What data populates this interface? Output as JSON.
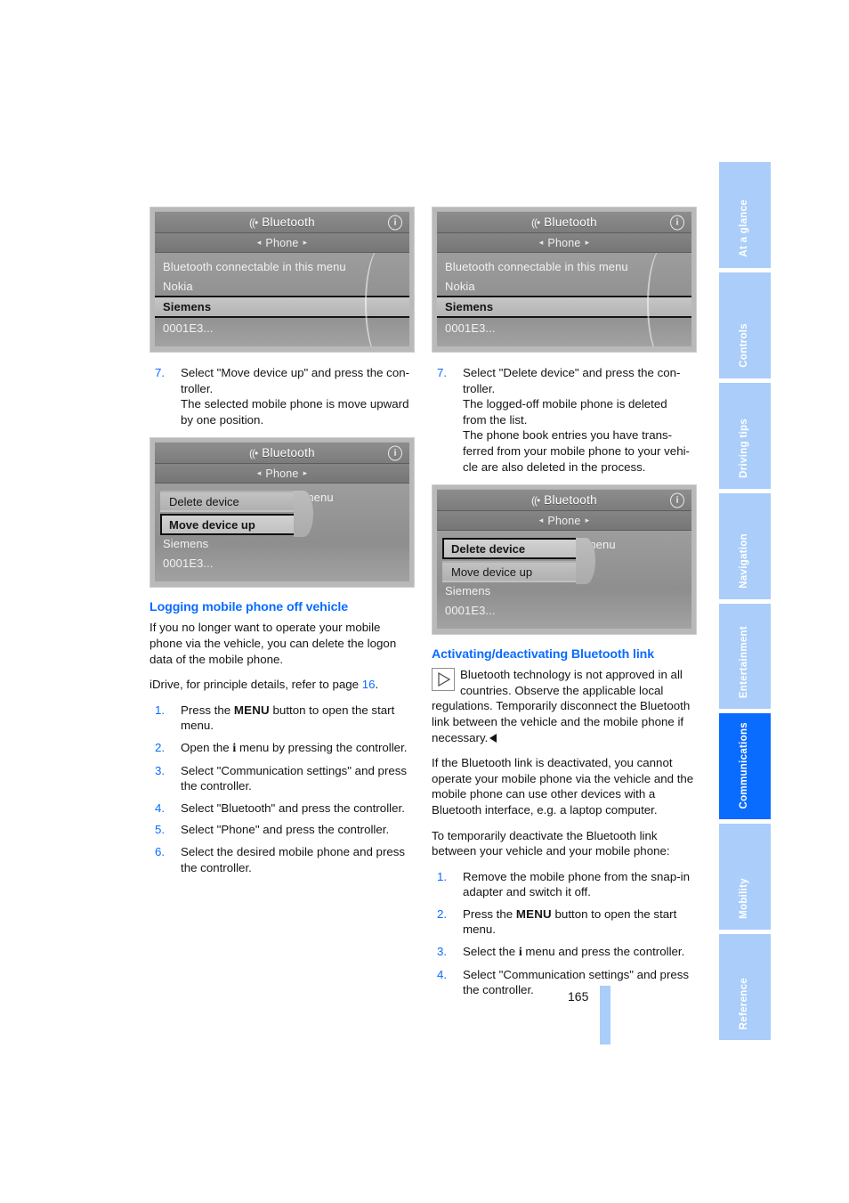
{
  "page": {
    "number": "165"
  },
  "sidebar": {
    "tabs": [
      {
        "label": "At a glance",
        "active": false
      },
      {
        "label": "Controls",
        "active": false
      },
      {
        "label": "Driving tips",
        "active": false
      },
      {
        "label": "Navigation",
        "active": false
      },
      {
        "label": "Entertainment",
        "active": false
      },
      {
        "label": "Communications",
        "active": true
      },
      {
        "label": "Mobility",
        "active": false
      },
      {
        "label": "Reference",
        "active": false
      }
    ],
    "active_color": "#0a6bff",
    "inactive_color": "#aacdfa"
  },
  "screenshots": {
    "shot1": {
      "title": "Bluetooth",
      "wave_icon": "((•",
      "info_badge": "i",
      "subtitle": "Phone",
      "arrow_left": "◂",
      "arrow_right": "▸",
      "rows": [
        {
          "text": "Bluetooth connectable in this menu",
          "selected": false
        },
        {
          "text": "Nokia",
          "selected": false
        },
        {
          "text": "Siemens",
          "selected": true
        },
        {
          "text": "0001E3...",
          "selected": false
        }
      ]
    },
    "shot2": {
      "title": "Bluetooth",
      "wave_icon": "((•",
      "info_badge": "i",
      "subtitle": "Phone",
      "arrow_left": "◂",
      "arrow_right": "▸",
      "background_row": "ble in this menu",
      "popup": [
        {
          "text": "Delete device",
          "selected": false
        },
        {
          "text": "Move device up",
          "selected": true
        }
      ],
      "rows": [
        {
          "text": "Siemens",
          "selected": false
        },
        {
          "text": "0001E3...",
          "selected": false
        }
      ]
    },
    "shot3": {
      "title": "Bluetooth",
      "wave_icon": "((•",
      "info_badge": "i",
      "subtitle": "Phone",
      "arrow_left": "◂",
      "arrow_right": "▸",
      "rows": [
        {
          "text": "Bluetooth connectable in this menu",
          "selected": false
        },
        {
          "text": "Nokia",
          "selected": false
        },
        {
          "text": "Siemens",
          "selected": true
        },
        {
          "text": "0001E3...",
          "selected": false
        }
      ]
    },
    "shot4": {
      "title": "Bluetooth",
      "wave_icon": "((•",
      "info_badge": "i",
      "subtitle": "Phone",
      "arrow_left": "◂",
      "arrow_right": "▸",
      "background_row": "ble in this menu",
      "popup": [
        {
          "text": "Delete device",
          "selected": true
        },
        {
          "text": "Move device up",
          "selected": false
        }
      ],
      "rows": [
        {
          "text": "Siemens",
          "selected": false
        },
        {
          "text": "0001E3...",
          "selected": false
        }
      ]
    }
  },
  "left_column": {
    "step7": {
      "num": "7.",
      "line1": "Select \"Move device up\" and press the con-",
      "line2": "troller.",
      "line3": "The selected mobile phone is move upward",
      "line4": "by one position."
    },
    "heading": "Logging mobile phone off vehicle",
    "intro": "If you no longer want to operate your mobile phone via the vehicle, you can delete the logon data of the mobile phone.",
    "idrive_pre": "iDrive, for principle details, refer to page ",
    "idrive_page": "16",
    "idrive_post": ".",
    "steps": [
      {
        "num": "1.",
        "pre": "Press the ",
        "kbd": "MENU",
        "post": " button to open the start menu."
      },
      {
        "num": "2.",
        "pre": "Open the ",
        "ichar": "i",
        "post": " menu by pressing the controller."
      },
      {
        "num": "3.",
        "pre": "Select \"Communication settings\" and press the controller.",
        "kbd": "",
        "post": ""
      },
      {
        "num": "4.",
        "pre": "Select \"Bluetooth\" and press the controller.",
        "kbd": "",
        "post": ""
      },
      {
        "num": "5.",
        "pre": "Select \"Phone\" and press the controller.",
        "kbd": "",
        "post": ""
      },
      {
        "num": "6.",
        "pre": "Select the desired mobile phone and press the controller.",
        "kbd": "",
        "post": ""
      }
    ]
  },
  "right_column": {
    "step7": {
      "num": "7.",
      "line1": "Select \"Delete device\" and press the con-",
      "line2": "troller.",
      "line3": "The logged-off mobile phone is deleted",
      "line4": "from the list.",
      "line5": "The phone book entries you have trans-",
      "line6": "ferred from your mobile phone to your vehi-",
      "line7": "cle are also deleted in the process."
    },
    "heading": "Activating/deactivating Bluetooth link",
    "note": "Bluetooth technology is not approved in all countries. Observe the applicable local regulations. Temporarily disconnect the Bluetooth link between the vehicle and the mobile phone if necessary.",
    "note_icon": "triangle-right",
    "para1": "If the Bluetooth link is deactivated, you cannot operate your mobile phone via the vehicle and the mobile phone can use other devices with a Bluetooth interface, e.g. a laptop computer.",
    "para2": "To temporarily deactivate the Bluetooth link between your vehicle and your mobile phone:",
    "steps": [
      {
        "num": "1.",
        "pre": "Remove the mobile phone from the snap-in adapter and switch it off.",
        "kbd": "",
        "post": ""
      },
      {
        "num": "2.",
        "pre": "Press the ",
        "kbd": "MENU",
        "post": " button to open the start menu."
      },
      {
        "num": "3.",
        "pre": "Select the ",
        "ichar": "i",
        "post": " menu and press the controller."
      },
      {
        "num": "4.",
        "pre": "Select \"Communication settings\" and press the controller.",
        "kbd": "",
        "post": ""
      }
    ]
  }
}
